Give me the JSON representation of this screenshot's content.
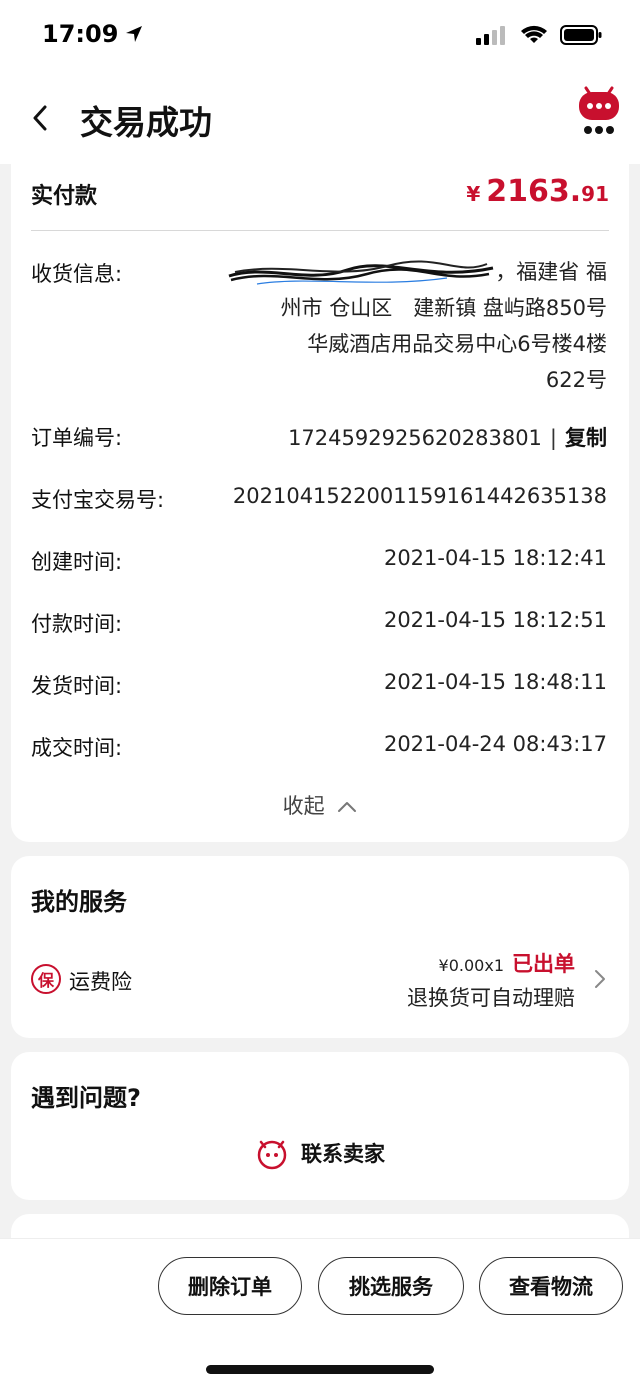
{
  "status_bar": {
    "time": "17:09"
  },
  "nav": {
    "title": "交易成功"
  },
  "payment": {
    "label": "实付款",
    "currency": "¥",
    "amount_int": "2163.",
    "amount_dec": "91"
  },
  "shipping": {
    "label": "收货信息:",
    "address_line1_suffix": "，福建省 福",
    "address_line2": "州市 仓山区　建新镇 盘屿路850号",
    "address_line3": "华威酒店用品交易中心6号楼4楼",
    "address_line4": "622号"
  },
  "order": {
    "number_label": "订单编号:",
    "number": "1724592925620283801",
    "separator": "|",
    "copy_label": "复制",
    "alipay_label": "支付宝交易号:",
    "alipay_no": "2021041522001159161442635138",
    "created_label": "创建时间:",
    "created": "2021-04-15 18:12:41",
    "paid_label": "付款时间:",
    "paid": "2021-04-15 18:12:51",
    "shipped_label": "发货时间:",
    "shipped": "2021-04-15 18:48:11",
    "closed_label": "成交时间:",
    "closed": "2021-04-24 08:43:17",
    "collapse_label": "收起"
  },
  "services": {
    "title": "我的服务",
    "icon_char": "保",
    "name": "运费险",
    "price": "¥0.00x1",
    "status": "已出单",
    "desc": "退换货可自动理赔"
  },
  "problem": {
    "title": "遇到问题?",
    "contact_label": "联系卖家"
  },
  "actions": {
    "delete": "删除订单",
    "pick_service": "挑选服务",
    "logistics": "查看物流"
  },
  "colors": {
    "accent": "#c8102e"
  }
}
